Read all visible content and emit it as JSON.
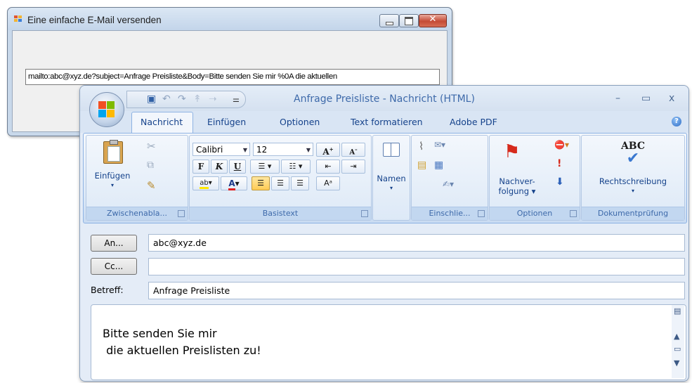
{
  "background_window": {
    "title": "Eine einfache E-Mail versenden",
    "mailto_value": "mailto:abc@xyz.de?subject=Anfrage Preisliste&Body=Bitte senden Sie mir %0A die aktuellen"
  },
  "outlook": {
    "window_title": "Anfrage Preisliste - Nachricht (HTML)",
    "window_controls": {
      "minimize": "–",
      "maximize": "▭",
      "close": "x"
    },
    "tabs": [
      {
        "label": "Nachricht",
        "active": true
      },
      {
        "label": "Einfügen"
      },
      {
        "label": "Optionen"
      },
      {
        "label": "Text formatieren"
      },
      {
        "label": "Adobe PDF"
      }
    ],
    "ribbon": {
      "clipboard": {
        "paste_label": "Einfügen",
        "group_label": "Zwischenabla..."
      },
      "basic_text": {
        "font": "Calibri",
        "size": "12",
        "bold": "F",
        "italic": "K",
        "underline": "U",
        "grow": "A",
        "shrink": "A",
        "font_color": "A",
        "group_label": "Basistext"
      },
      "names": {
        "label": "Namen"
      },
      "include": {
        "group_label": "Einschlie..."
      },
      "options": {
        "followup_line1": "Nachver-",
        "followup_line2": "folgung",
        "group_label": "Optionen"
      },
      "proofing": {
        "abc": "ABC",
        "label": "Rechtschreibung",
        "group_label": "Dokumentprüfung"
      }
    },
    "header": {
      "to_button": "An...",
      "to_value": "abc@xyz.de",
      "cc_button": "Cc...",
      "cc_value": "",
      "subject_label": "Betreff:",
      "subject_value": "Anfrage Preisliste"
    },
    "body": {
      "line1": "Bitte senden Sie mir",
      "line2": " die aktuellen Preislisten zu!"
    }
  },
  "colors": {
    "accent_text": "#15428b",
    "title_text": "#3e6aaa",
    "ribbon_bg": "#dbe8f7",
    "close_red": "#c44a35"
  }
}
